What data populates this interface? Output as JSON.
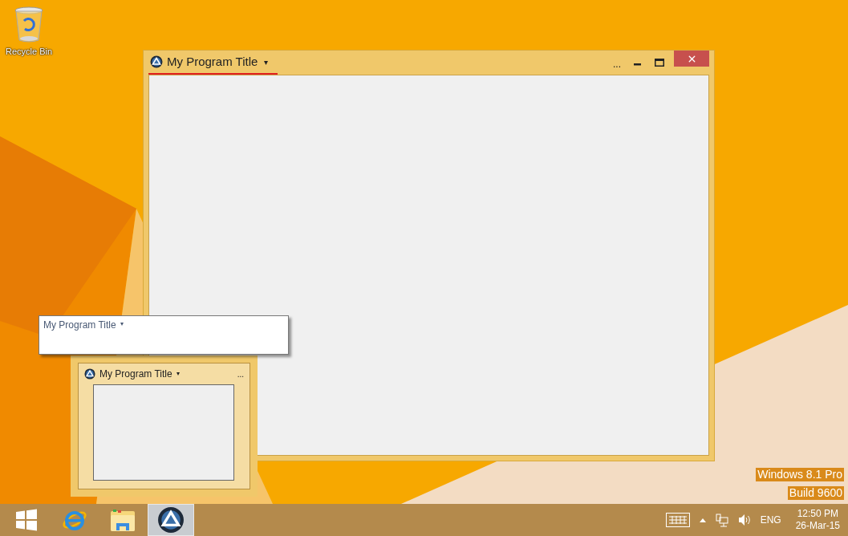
{
  "desktop": {
    "icons": [
      {
        "label": "Recycle Bin"
      }
    ],
    "os_label": [
      "Windows 8.1 Pro",
      "Build 9600"
    ]
  },
  "window": {
    "title": "My Program Title",
    "arrow": "▾",
    "overflow": "..."
  },
  "tooltip": {
    "title": "My Program Title",
    "arrow": "▾"
  },
  "preview": {
    "title": "My Program Title",
    "arrow": "▾",
    "overflow": "..."
  },
  "taskbar": {
    "apps": [
      {
        "kind": "start",
        "selected": false
      },
      {
        "kind": "browser",
        "selected": false
      },
      {
        "kind": "folder",
        "selected": false
      },
      {
        "kind": "program",
        "selected": true
      }
    ],
    "tray": {
      "language": "ENG",
      "time": "12:50 PM",
      "date": "26-Mar-15"
    }
  }
}
